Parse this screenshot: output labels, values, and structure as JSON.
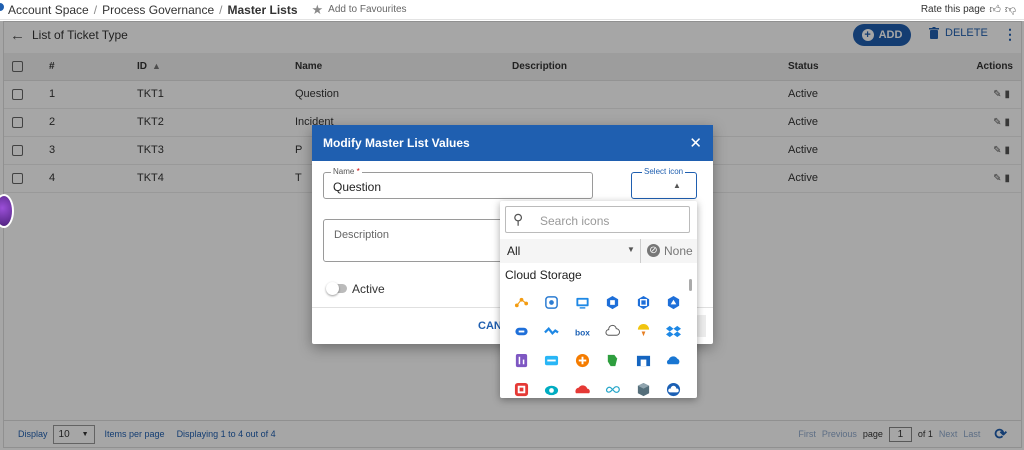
{
  "breadcrumb": {
    "items": [
      "Account Space",
      "Process Governance",
      "Master Lists"
    ],
    "favourite_label": "Add to Favourites",
    "rate_label": "Rate this page"
  },
  "list": {
    "title": "List of Ticket Type",
    "add_label": "ADD",
    "delete_label": "DELETE",
    "columns": [
      "#",
      "ID",
      "Name",
      "Description",
      "Status",
      "Actions"
    ],
    "rows": [
      {
        "num": "1",
        "id": "TKT1",
        "name": "Question",
        "description": "",
        "status": "Active"
      },
      {
        "num": "2",
        "id": "TKT2",
        "name": "Incident",
        "description": "",
        "status": "Active"
      },
      {
        "num": "3",
        "id": "TKT3",
        "name": "P",
        "description": "",
        "status": "Active"
      },
      {
        "num": "4",
        "id": "TKT4",
        "name": "T",
        "description": "",
        "status": "Active"
      }
    ]
  },
  "footer": {
    "display_label": "Display",
    "page_size": "10",
    "items_per_page_label": "Items per page",
    "displaying_text": "Displaying 1 to 4 out of 4",
    "first_label": "First",
    "previous_label": "Previous",
    "page_label": "page",
    "current_page": "1",
    "of_label": "of 1",
    "next_label": "Next",
    "last_label": "Last"
  },
  "modal": {
    "title": "Modify Master List Values",
    "name_label": "Name",
    "name_required_mark": "*",
    "name_value": "Question",
    "icon_label": "Select icon",
    "description_placeholder": "Description",
    "active_label": "Active",
    "cancel_label": "CAN"
  },
  "icon_picker": {
    "search_placeholder": "Search icons",
    "filter_value": "All",
    "none_label": "None",
    "category": "Cloud Storage",
    "icons": [
      {
        "name": "nodes-network-icon",
        "color": "#f39c12"
      },
      {
        "name": "cloud-sync-icon",
        "color": "#2d7dd2"
      },
      {
        "name": "monitor-cloud-icon",
        "color": "#1e88e5"
      },
      {
        "name": "storage-chip-icon",
        "color": "#1e6fd9"
      },
      {
        "name": "storage-chip-alt-icon",
        "color": "#1e6fd9"
      },
      {
        "name": "hexagon-drive-icon",
        "color": "#1e6fd9"
      },
      {
        "name": "cloud-database-icon",
        "color": "#1e6fd9"
      },
      {
        "name": "wave-cloud-icon",
        "color": "#1e88e5"
      },
      {
        "name": "box-logo-icon",
        "color": "#1a5fb4"
      },
      {
        "name": "cloud-outline-icon",
        "color": "#555555"
      },
      {
        "name": "shield-cloud-icon",
        "color": "#f1c40f"
      },
      {
        "name": "dropbox-icon",
        "color": "#1e88e5"
      },
      {
        "name": "heroku-icon",
        "color": "#7e57c2"
      },
      {
        "name": "mega-icon",
        "color": "#29b6f6"
      },
      {
        "name": "plus-circle-icon",
        "color": "#f57c00"
      },
      {
        "name": "evernote-icon",
        "color": "#2e9e3e"
      },
      {
        "name": "arch-gate-icon",
        "color": "#1565c0"
      },
      {
        "name": "onedrive-icon",
        "color": "#1976d2"
      },
      {
        "name": "red-square-icon",
        "color": "#e53935"
      },
      {
        "name": "eye-cloud-icon",
        "color": "#00acc1"
      },
      {
        "name": "red-cloud-icon",
        "color": "#e53935"
      },
      {
        "name": "infinity-cloud-icon",
        "color": "#26a6c9"
      },
      {
        "name": "cube-box-icon",
        "color": "#546e7a"
      },
      {
        "name": "cloud-circle-icon",
        "color": "#1a5fb4"
      }
    ]
  },
  "colors": {
    "primary": "#1f5fb0",
    "overlay": "rgba(0,0,0,0.35)"
  }
}
